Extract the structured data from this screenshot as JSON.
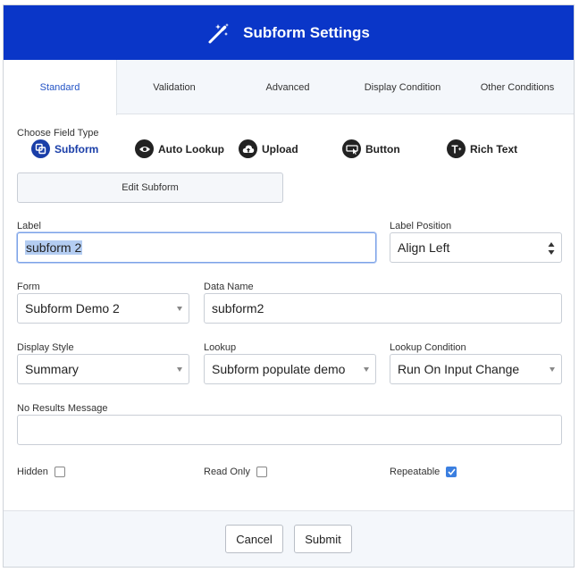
{
  "header": {
    "title": "Subform Settings",
    "icon": "magic-wand-icon"
  },
  "tabs": [
    {
      "label": "Standard",
      "active": true
    },
    {
      "label": "Validation"
    },
    {
      "label": "Advanced"
    },
    {
      "label": "Display Condition"
    },
    {
      "label": "Other Conditions"
    }
  ],
  "field_type": {
    "label": "Choose Field Type",
    "options": [
      {
        "label": "Subform",
        "icon": "subform-icon",
        "selected": true
      },
      {
        "label": "Auto Lookup",
        "icon": "eye-icon"
      },
      {
        "label": "Upload",
        "icon": "cloud-upload-icon"
      },
      {
        "label": "Button",
        "icon": "button-cursor-icon"
      },
      {
        "label": "Rich Text",
        "icon": "rich-text-icon"
      }
    ],
    "edit_button": "Edit Subform"
  },
  "fields": {
    "label": {
      "label": "Label",
      "value": "subform 2"
    },
    "label_position": {
      "label": "Label Position",
      "value": "Align Left"
    },
    "form": {
      "label": "Form",
      "value": "Subform Demo 2"
    },
    "data_name": {
      "label": "Data Name",
      "value": "subform2"
    },
    "display_style": {
      "label": "Display Style",
      "value": "Summary"
    },
    "lookup": {
      "label": "Lookup",
      "value": "Subform populate demo"
    },
    "lookup_condition": {
      "label": "Lookup Condition",
      "value": "Run On Input Change"
    },
    "no_results": {
      "label": "No Results Message",
      "value": ""
    }
  },
  "checks": {
    "hidden": {
      "label": "Hidden",
      "checked": false
    },
    "read_only": {
      "label": "Read Only",
      "checked": false
    },
    "repeatable": {
      "label": "Repeatable",
      "checked": true
    }
  },
  "footer": {
    "cancel": "Cancel",
    "submit": "Submit"
  },
  "colors": {
    "header": "#0a36c8",
    "accent": "#1a3ea8",
    "checkbox": "#3b7fe0"
  }
}
